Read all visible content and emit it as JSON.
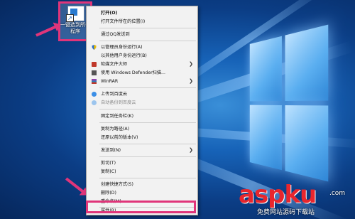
{
  "desktop_icon": {
    "label": "一键选到所有\n程序"
  },
  "context_menu": {
    "items": [
      {
        "label": "打开(O)",
        "bold": true
      },
      {
        "label": "打开文件所在的位置(I)"
      },
      {
        "label": "通过QQ发送到"
      },
      {
        "label": "以管理员身份运行(A)",
        "icon": "shield-icon"
      },
      {
        "label": "以其他用户身份运行(B)"
      },
      {
        "label": "软媒文件大师",
        "icon": "tool-icon",
        "submenu": true
      },
      {
        "label": "使用 Windows Defender扫描...",
        "icon": "defender-icon"
      },
      {
        "label": "WinRAR",
        "icon": "winrar-icon",
        "submenu": true
      },
      {
        "label": "上传到百度云",
        "icon": "baidu-cloud-icon"
      },
      {
        "label": "自动备份到百度云",
        "icon": "baidu-cloud-icon",
        "disabled": true
      },
      {
        "label": "固定到任务栏(K)"
      },
      {
        "label": "复制为路径(A)"
      },
      {
        "label": "还原以前的版本(V)"
      },
      {
        "label": "发送到(N)",
        "submenu": true
      },
      {
        "label": "剪切(T)"
      },
      {
        "label": "复制(C)"
      },
      {
        "label": "创建快捷方式(S)"
      },
      {
        "label": "删除(D)"
      },
      {
        "label": "重命名(M)"
      },
      {
        "label": "属性(R)"
      }
    ],
    "submenu_glyph": "❯"
  },
  "watermark": {
    "big": "aspku",
    "small": "免费网站源码下载站",
    "tld": ".com"
  },
  "colors": {
    "highlight": "#e0357a",
    "menu_bg": "#f2f2f2",
    "desktop": "#0b3d85"
  }
}
